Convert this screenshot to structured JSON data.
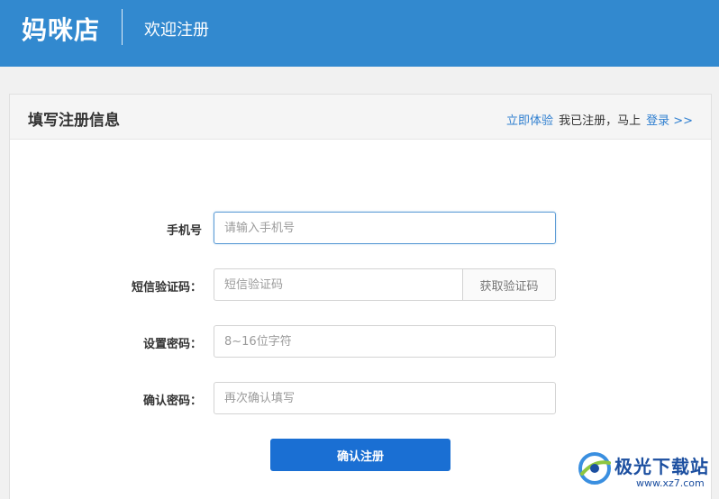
{
  "header": {
    "brand": "妈咪店",
    "subtitle": "欢迎注册"
  },
  "panel": {
    "title": "填写注册信息",
    "try_link": "立即体验",
    "registered_text": "我已注册，马上",
    "login_link": "登录 >>"
  },
  "form": {
    "phone": {
      "label": "手机号",
      "placeholder": "请输入手机号",
      "value": ""
    },
    "sms_code": {
      "label": "短信验证码：",
      "placeholder": "短信验证码",
      "value": "",
      "button": "获取验证码"
    },
    "password": {
      "label": "设置密码：",
      "placeholder": "8~16位字符",
      "value": ""
    },
    "confirm_password": {
      "label": "确认密码：",
      "placeholder": "再次确认填写",
      "value": ""
    },
    "submit": "确认注册"
  },
  "watermark": {
    "name": "极光下载站",
    "url": "www.xz7.com"
  },
  "colors": {
    "header_bg": "#3289cf",
    "primary_button": "#1a6fd3",
    "link": "#2f7fd0"
  }
}
